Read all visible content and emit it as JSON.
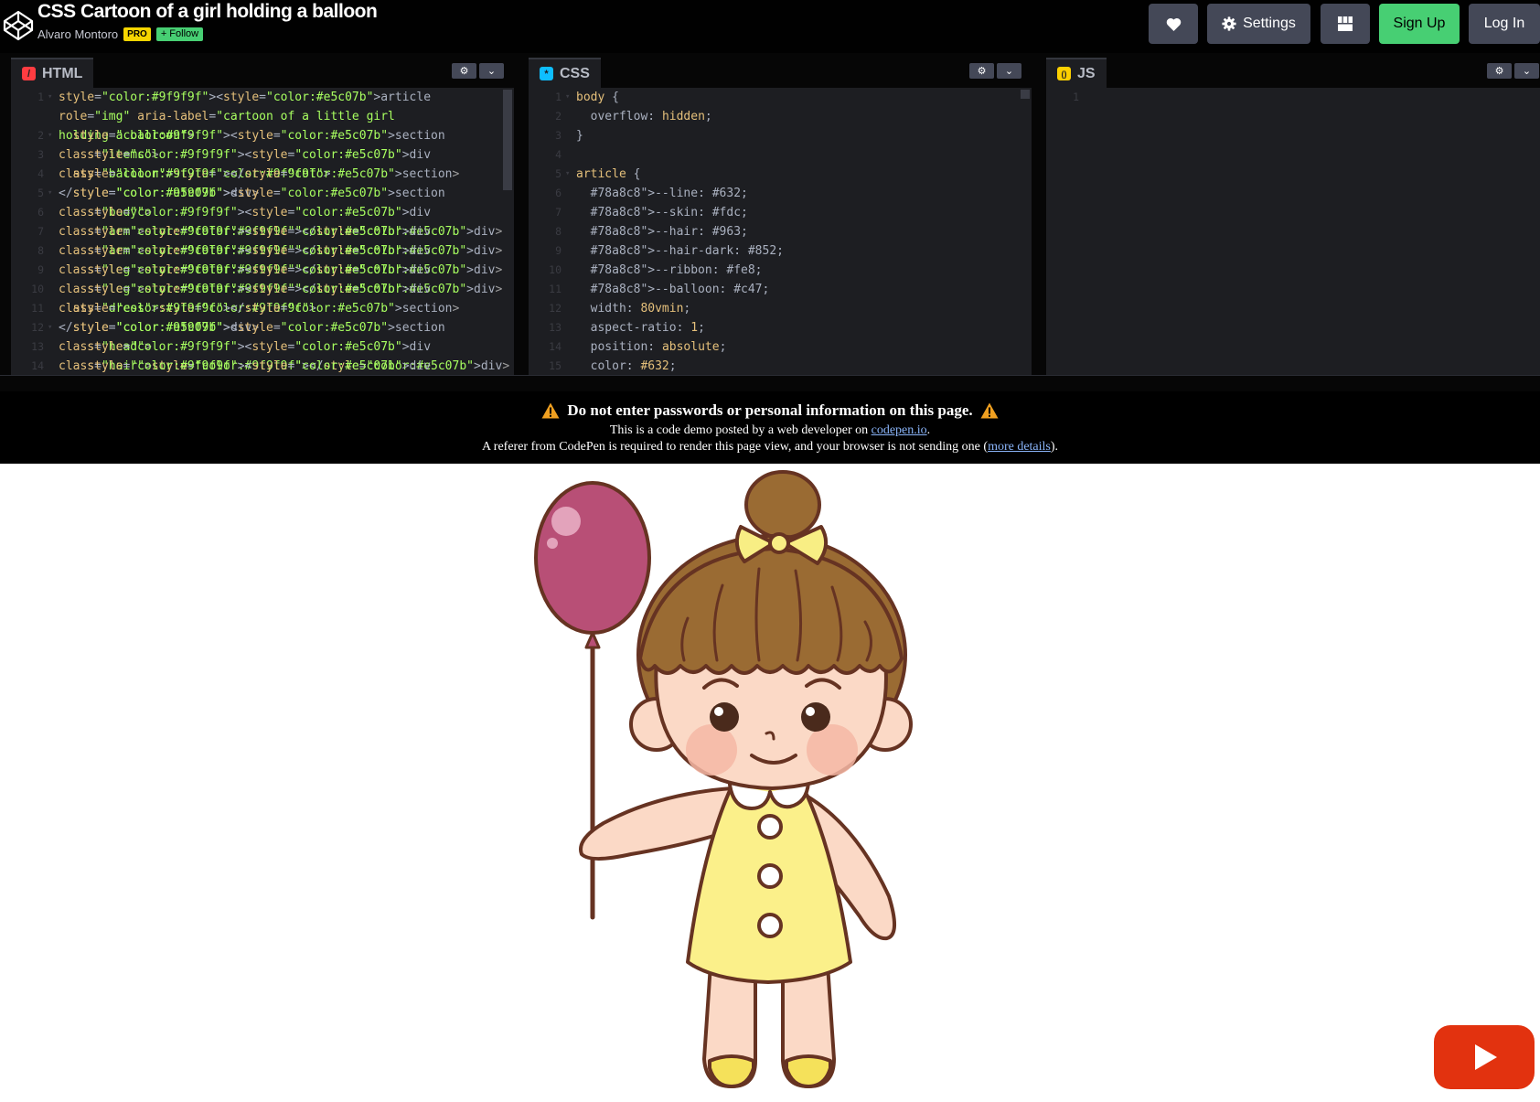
{
  "header": {
    "pen_title": "CSS Cartoon of a girl holding a balloon",
    "author": "Alvaro Montoro",
    "pro_badge": "PRO",
    "follow_label": "+ Follow",
    "buttons": {
      "heart_icon": "heart-icon",
      "settings_label": "Settings",
      "layout_icon": "layout-grid-icon",
      "signup_label": "Sign Up",
      "login_label": "Log In"
    }
  },
  "editors": {
    "html": {
      "tab_label": "HTML",
      "icon": "/",
      "lines": [
        {
          "n": "1",
          "fold": true,
          "text": "<article role=\"img\" aria-label=\"cartoon of a little girl holding a balloon\">",
          "wrap": true
        },
        {
          "n": "2",
          "fold": true,
          "text": "  <section class=\"items\">"
        },
        {
          "n": "3",
          "text": "    <div class=\"balloon\"></div>"
        },
        {
          "n": "4",
          "text": "  </section>"
        },
        {
          "n": "5",
          "fold": true,
          "text": "  <section class=\"body\">"
        },
        {
          "n": "6",
          "text": "    <div class=\"arm\"></div>"
        },
        {
          "n": "7",
          "text": "    <div class=\"arm\"></div>"
        },
        {
          "n": "8",
          "text": "    <div class=\"leg\"></div>"
        },
        {
          "n": "9",
          "text": "    <div class=\"leg\"></div>"
        },
        {
          "n": "10",
          "text": "    <div class=\"dress\"></div>"
        },
        {
          "n": "11",
          "text": "  </section>"
        },
        {
          "n": "12",
          "fold": true,
          "text": "  <section class=\"head\">"
        },
        {
          "n": "13",
          "text": "    <div class=\"hair\"></div>"
        },
        {
          "n": "14",
          "text": "    <div class=\"ear\"></div>"
        }
      ]
    },
    "css": {
      "tab_label": "CSS",
      "icon": "*",
      "lines": [
        {
          "n": "1",
          "fold": true,
          "text": "body {"
        },
        {
          "n": "2",
          "text": "  overflow: hidden;"
        },
        {
          "n": "3",
          "text": "}"
        },
        {
          "n": "4",
          "text": ""
        },
        {
          "n": "5",
          "fold": true,
          "text": "article {"
        },
        {
          "n": "6",
          "text": "  --line: #632;"
        },
        {
          "n": "7",
          "text": "  --skin: #fdc;"
        },
        {
          "n": "8",
          "text": "  --hair: #963;"
        },
        {
          "n": "9",
          "text": "  --hair-dark: #852;"
        },
        {
          "n": "10",
          "text": "  --ribbon: #fe8;"
        },
        {
          "n": "11",
          "text": "  --balloon: #c47;"
        },
        {
          "n": "12",
          "text": "  width: 80vmin;"
        },
        {
          "n": "13",
          "text": "  aspect-ratio: 1;"
        },
        {
          "n": "14",
          "text": "  position: absolute;"
        },
        {
          "n": "15",
          "text": "  color: #632;"
        }
      ]
    },
    "js": {
      "tab_label": "JS",
      "icon": "()",
      "lines": [
        {
          "n": "1",
          "text": ""
        }
      ]
    },
    "settings_icon": "gear-icon",
    "collapse_icon": "chevron-down-icon"
  },
  "warning": {
    "title": "Do not enter passwords or personal information on this page.",
    "line1_prefix": "This is a code demo posted by a web developer on ",
    "line1_link": "codepen.io",
    "line1_suffix": ".",
    "line2_prefix": "A referer from CodePen is required to render this page view, and your browser is not sending one (",
    "line2_link": "more details",
    "line2_suffix": ")."
  },
  "preview": {
    "image": "cartoon of a little girl holding a balloon",
    "play_icon": "youtube-play-icon"
  },
  "colors": {
    "line": "#663322",
    "skin": "#ffddcc",
    "hair": "#996633",
    "hair_dark": "#885522",
    "ribbon": "#ffee88",
    "balloon": "#cc4477",
    "dress": "#fbf08a",
    "signup": "#47cf73",
    "pro": "#f5d500"
  }
}
